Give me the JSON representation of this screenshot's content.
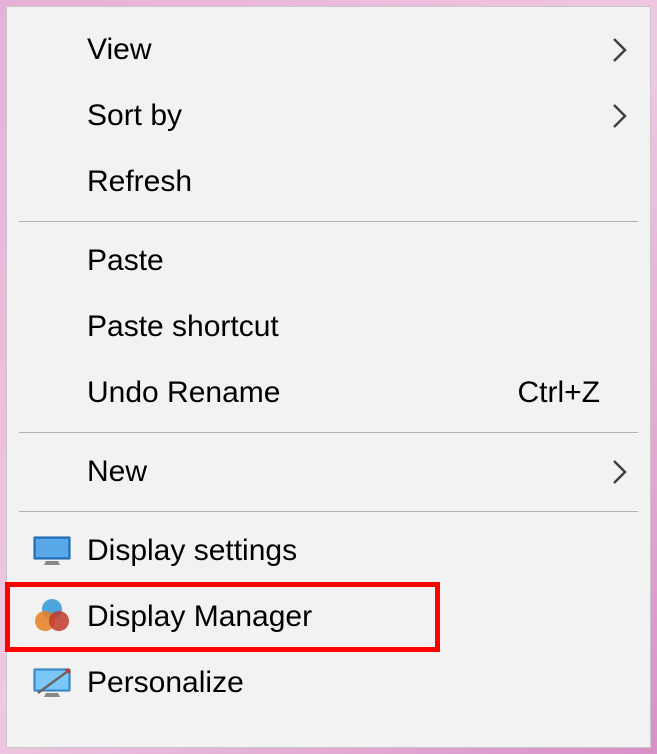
{
  "menu": {
    "items": [
      {
        "label": "View",
        "hasSubmenu": true,
        "icon": null,
        "shortcut": null
      },
      {
        "label": "Sort by",
        "hasSubmenu": true,
        "icon": null,
        "shortcut": null
      },
      {
        "label": "Refresh",
        "hasSubmenu": false,
        "icon": null,
        "shortcut": null
      },
      {
        "separator": true
      },
      {
        "label": "Paste",
        "hasSubmenu": false,
        "icon": null,
        "shortcut": null
      },
      {
        "label": "Paste shortcut",
        "hasSubmenu": false,
        "icon": null,
        "shortcut": null
      },
      {
        "label": "Undo Rename",
        "hasSubmenu": false,
        "icon": null,
        "shortcut": "Ctrl+Z"
      },
      {
        "separator": true
      },
      {
        "label": "New",
        "hasSubmenu": true,
        "icon": null,
        "shortcut": null
      },
      {
        "separator": true
      },
      {
        "label": "Display settings",
        "hasSubmenu": false,
        "icon": "monitor-icon",
        "shortcut": null
      },
      {
        "label": "Display Manager",
        "hasSubmenu": false,
        "icon": "color-circles-icon",
        "shortcut": null,
        "highlighted": true
      },
      {
        "label": "Personalize",
        "hasSubmenu": false,
        "icon": "personalize-icon",
        "shortcut": null
      }
    ]
  }
}
